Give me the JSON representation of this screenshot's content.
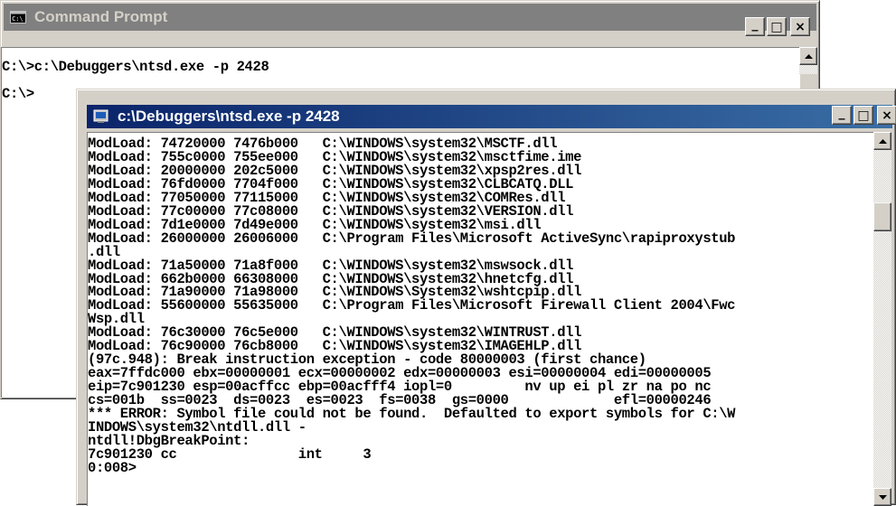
{
  "back_window": {
    "title": "Command Prompt",
    "icon": "console-icon",
    "controls": {
      "minimize": "_",
      "maximize": "□",
      "close": "×"
    },
    "lines": [
      "C:\\>c:\\Debuggers\\ntsd.exe -p 2428",
      "",
      "C:\\>"
    ]
  },
  "front_window": {
    "title": "c:\\Debuggers\\ntsd.exe -p 2428",
    "icon": "debugger-app-icon",
    "controls": {
      "minimize": "_",
      "maximize": "□",
      "close": "×"
    },
    "lines": [
      "ModLoad: 74720000 7476b000   C:\\WINDOWS\\system32\\MSCTF.dll",
      "ModLoad: 755c0000 755ee000   C:\\WINDOWS\\system32\\msctfime.ime",
      "ModLoad: 20000000 202c5000   C:\\WINDOWS\\system32\\xpsp2res.dll",
      "ModLoad: 76fd0000 7704f000   C:\\WINDOWS\\system32\\CLBCATQ.DLL",
      "ModLoad: 77050000 77115000   C:\\WINDOWS\\system32\\COMRes.dll",
      "ModLoad: 77c00000 77c08000   C:\\WINDOWS\\system32\\VERSION.dll",
      "ModLoad: 7d1e0000 7d49e000   C:\\WINDOWS\\system32\\msi.dll",
      "ModLoad: 26000000 26006000   C:\\Program Files\\Microsoft ActiveSync\\rapiproxystub",
      ".dll",
      "ModLoad: 71a50000 71a8f000   C:\\WINDOWS\\system32\\mswsock.dll",
      "ModLoad: 662b0000 66308000   C:\\WINDOWS\\system32\\hnetcfg.dll",
      "ModLoad: 71a90000 71a98000   C:\\WINDOWS\\System32\\wshtcpip.dll",
      "ModLoad: 55600000 55635000   C:\\Program Files\\Microsoft Firewall Client 2004\\Fwc",
      "Wsp.dll",
      "ModLoad: 76c30000 76c5e000   C:\\WINDOWS\\system32\\WINTRUST.dll",
      "ModLoad: 76c90000 76cb8000   C:\\WINDOWS\\system32\\IMAGEHLP.dll",
      "(97c.948): Break instruction exception - code 80000003 (first chance)",
      "eax=7ffdc000 ebx=00000001 ecx=00000002 edx=00000003 esi=00000004 edi=00000005",
      "eip=7c901230 esp=00acffcc ebp=00acfff4 iopl=0         nv up ei pl zr na po nc",
      "cs=001b  ss=0023  ds=0023  es=0023  fs=0038  gs=0000             efl=00000246",
      "*** ERROR: Symbol file could not be found.  Defaulted to export symbols for C:\\W",
      "INDOWS\\system32\\ntdll.dll -",
      "ntdll!DbgBreakPoint:",
      "7c901230 cc               int     3",
      "0:008>"
    ]
  }
}
